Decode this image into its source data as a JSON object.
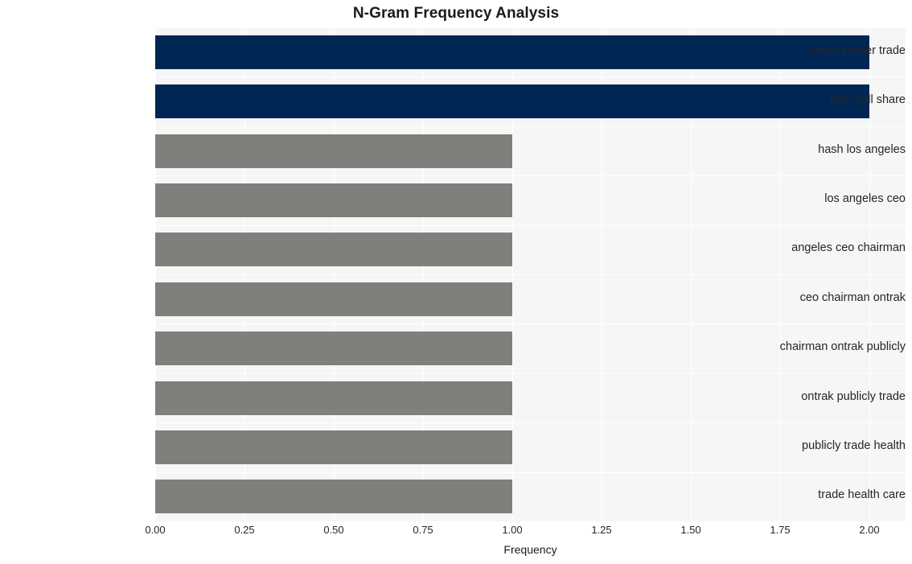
{
  "chart_data": {
    "type": "bar",
    "orientation": "horizontal",
    "title": "N-Gram Frequency Analysis",
    "xlabel": "Frequency",
    "ylabel": "",
    "xlim": [
      0,
      2
    ],
    "ylim": null,
    "grid": true,
    "legend": null,
    "xticks": [
      "0.00",
      "0.25",
      "0.50",
      "0.75",
      "1.00",
      "1.25",
      "1.50",
      "1.75",
      "2.00"
    ],
    "xtick_values": [
      0,
      0.25,
      0.5,
      0.75,
      1,
      1.25,
      1.5,
      1.75,
      2
    ],
    "categories": [
      "count insider trade",
      "plan sell share",
      "hash los angeles",
      "los angeles ceo",
      "angeles ceo chairman",
      "ceo chairman ontrak",
      "chairman ontrak publicly",
      "ontrak publicly trade",
      "publicly trade health",
      "trade health care"
    ],
    "values": [
      2,
      2,
      1,
      1,
      1,
      1,
      1,
      1,
      1,
      1
    ],
    "bar_colors": [
      "#002654",
      "#002654",
      "#7f7f7c",
      "#7f7f7c",
      "#7f7f7c",
      "#7f7f7c",
      "#7f7f7c",
      "#7f7f7c",
      "#7f7f7c",
      "#7f7f7c"
    ],
    "colors": {
      "highlight": "#002654",
      "default": "#7f7f7c",
      "plot_background": "#f6f6f6",
      "figure_background": "#ffffff",
      "gridline": "#ffffff",
      "text": "#262626"
    }
  }
}
